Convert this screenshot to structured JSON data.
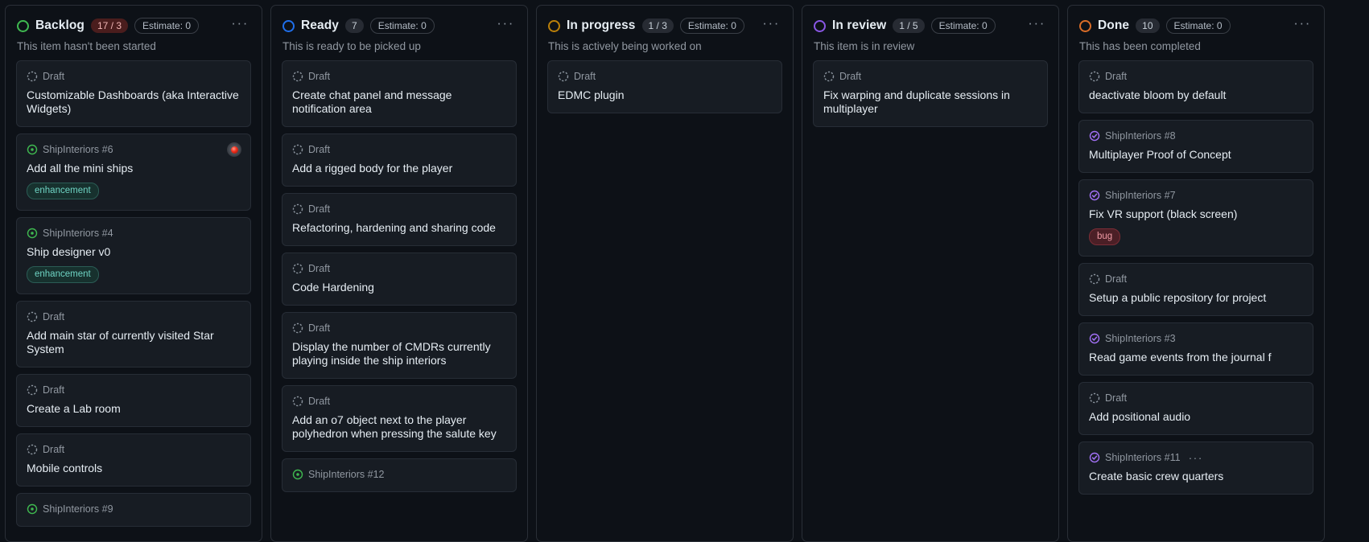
{
  "board": {
    "columns": [
      {
        "name": "Backlog",
        "dot_color": "#3fb950",
        "dot_class": "green",
        "count": "17 / 3",
        "count_over_limit": true,
        "estimate": "Estimate: 0",
        "description": "This item hasn't been started",
        "menu": "···",
        "cards": [
          {
            "meta": "Draft",
            "icon": "draft-icon",
            "title": "Customizable Dashboards (aka Interactive Widgets)",
            "labels": []
          },
          {
            "meta": "ShipInteriors #6",
            "icon": "open-issue-icon",
            "title": "Add all the mini ships",
            "labels": [
              {
                "text": "enhancement",
                "kind": "enhancement"
              }
            ],
            "avatar": "hal-avatar"
          },
          {
            "meta": "ShipInteriors #4",
            "icon": "open-issue-icon",
            "title": "Ship designer v0",
            "labels": [
              {
                "text": "enhancement",
                "kind": "enhancement"
              }
            ]
          },
          {
            "meta": "Draft",
            "icon": "draft-icon",
            "title": "Add main star of currently visited Star System",
            "labels": []
          },
          {
            "meta": "Draft",
            "icon": "draft-icon",
            "title": "Create a Lab room",
            "labels": []
          },
          {
            "meta": "Draft",
            "icon": "draft-icon",
            "title": "Mobile controls",
            "labels": []
          },
          {
            "meta": "ShipInteriors #9",
            "icon": "open-issue-icon",
            "title": "",
            "labels": []
          }
        ]
      },
      {
        "name": "Ready",
        "dot_color": "#1f6feb",
        "dot_class": "blue",
        "count": "7",
        "count_over_limit": false,
        "estimate": "Estimate: 0",
        "description": "This is ready to be picked up",
        "menu": "···",
        "cards": [
          {
            "meta": "Draft",
            "icon": "draft-icon",
            "title": "Create chat panel and message notification area",
            "labels": []
          },
          {
            "meta": "Draft",
            "icon": "draft-icon",
            "title": "Add a rigged body for the player",
            "labels": []
          },
          {
            "meta": "Draft",
            "icon": "draft-icon",
            "title": "Refactoring, hardening and sharing code",
            "labels": []
          },
          {
            "meta": "Draft",
            "icon": "draft-icon",
            "title": "Code Hardening",
            "labels": []
          },
          {
            "meta": "Draft",
            "icon": "draft-icon",
            "title": "Display the number of CMDRs currently playing inside the ship interiors",
            "labels": []
          },
          {
            "meta": "Draft",
            "icon": "draft-icon",
            "title": "Add an o7 object next to the player polyhedron when pressing the salute key",
            "labels": []
          },
          {
            "meta": "ShipInteriors #12",
            "icon": "open-issue-icon",
            "title": "",
            "labels": []
          }
        ]
      },
      {
        "name": "In progress",
        "dot_color": "#bb8009",
        "dot_class": "yellow",
        "count": "1 / 3",
        "count_over_limit": false,
        "estimate": "Estimate: 0",
        "description": "This is actively being worked on",
        "menu": "···",
        "cards": [
          {
            "meta": "Draft",
            "icon": "draft-icon",
            "title": "EDMC plugin",
            "labels": []
          }
        ]
      },
      {
        "name": "In review",
        "dot_color": "#8957e5",
        "dot_class": "purple",
        "count": "1 / 5",
        "count_over_limit": false,
        "estimate": "Estimate: 0",
        "description": "This item is in review",
        "menu": "···",
        "cards": [
          {
            "meta": "Draft",
            "icon": "draft-icon",
            "title": "Fix warping and duplicate sessions in multiplayer",
            "labels": []
          }
        ]
      },
      {
        "name": "Done",
        "dot_color": "#db6d28",
        "dot_class": "orange",
        "count": "10",
        "count_over_limit": false,
        "estimate": "Estimate: 0",
        "description": "This has been completed",
        "menu": "···",
        "cards": [
          {
            "meta": "Draft",
            "icon": "draft-icon",
            "title": "deactivate bloom by default",
            "labels": []
          },
          {
            "meta": "ShipInteriors #8",
            "icon": "closed-issue-icon",
            "title": "Multiplayer Proof of Concept",
            "labels": []
          },
          {
            "meta": "ShipInteriors #7",
            "icon": "closed-issue-icon",
            "title": "Fix VR support (black screen)",
            "labels": [
              {
                "text": "bug",
                "kind": "bug"
              }
            ]
          },
          {
            "meta": "Draft",
            "icon": "draft-icon",
            "title": "Setup a public repository for project",
            "labels": []
          },
          {
            "meta": "ShipInteriors #3",
            "icon": "closed-issue-icon",
            "title": "Read game events from the journal f",
            "labels": []
          },
          {
            "meta": "Draft",
            "icon": "draft-icon",
            "title": "Add positional audio",
            "labels": []
          },
          {
            "meta": "ShipInteriors #11",
            "icon": "closed-issue-icon",
            "title": "Create basic crew quarters",
            "labels": [],
            "kebab": "···"
          }
        ]
      }
    ]
  }
}
